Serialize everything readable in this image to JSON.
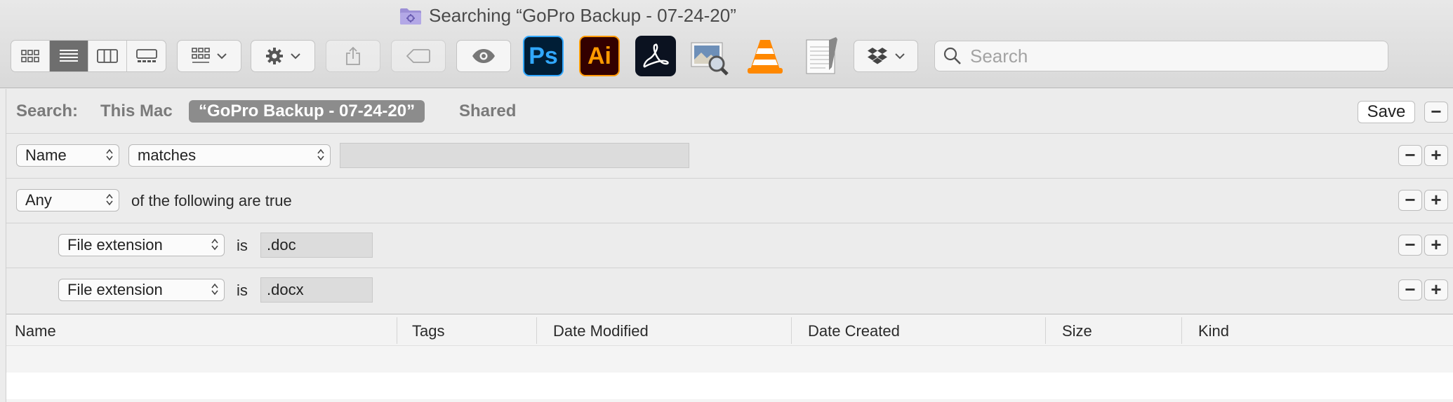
{
  "window": {
    "title": "Searching “GoPro Backup - 07-24-20”"
  },
  "toolbar": {
    "view_modes": [
      "icon-view",
      "list-view",
      "column-view",
      "gallery-view"
    ],
    "active_view": "list-view",
    "app_icons": [
      {
        "name": "photoshop",
        "text": "Ps",
        "fg": "#31a8ff",
        "bg": "#001e36"
      },
      {
        "name": "illustrator",
        "text": "Ai",
        "fg": "#ff9a00",
        "bg": "#330000"
      },
      {
        "name": "acrobat",
        "text": "",
        "fg": "#ffffff",
        "bg": "#0b1220"
      }
    ]
  },
  "search": {
    "placeholder": "Search",
    "value": ""
  },
  "scope": {
    "label": "Search:",
    "items": [
      "This Mac",
      "“GoPro Backup - 07-24-20”",
      "Shared"
    ],
    "selected_index": 1,
    "save_label": "Save"
  },
  "criteria": [
    {
      "attribute": "Name",
      "operator": "matches",
      "value": ""
    },
    {
      "attribute": "Any",
      "text": "of the following are true"
    },
    {
      "attribute": "File extension",
      "operator": "is",
      "value": ".doc"
    },
    {
      "attribute": "File extension",
      "operator": "is",
      "value": ".docx"
    }
  ],
  "buttons": {
    "minus": "−",
    "plus": "+"
  },
  "columns": [
    "Name",
    "Tags",
    "Date Modified",
    "Date Created",
    "Size",
    "Kind"
  ],
  "colors": {
    "selected_scope": "#8c8c8c",
    "active_view": "#6e6e6e",
    "stripe": "#f4f4f4"
  }
}
